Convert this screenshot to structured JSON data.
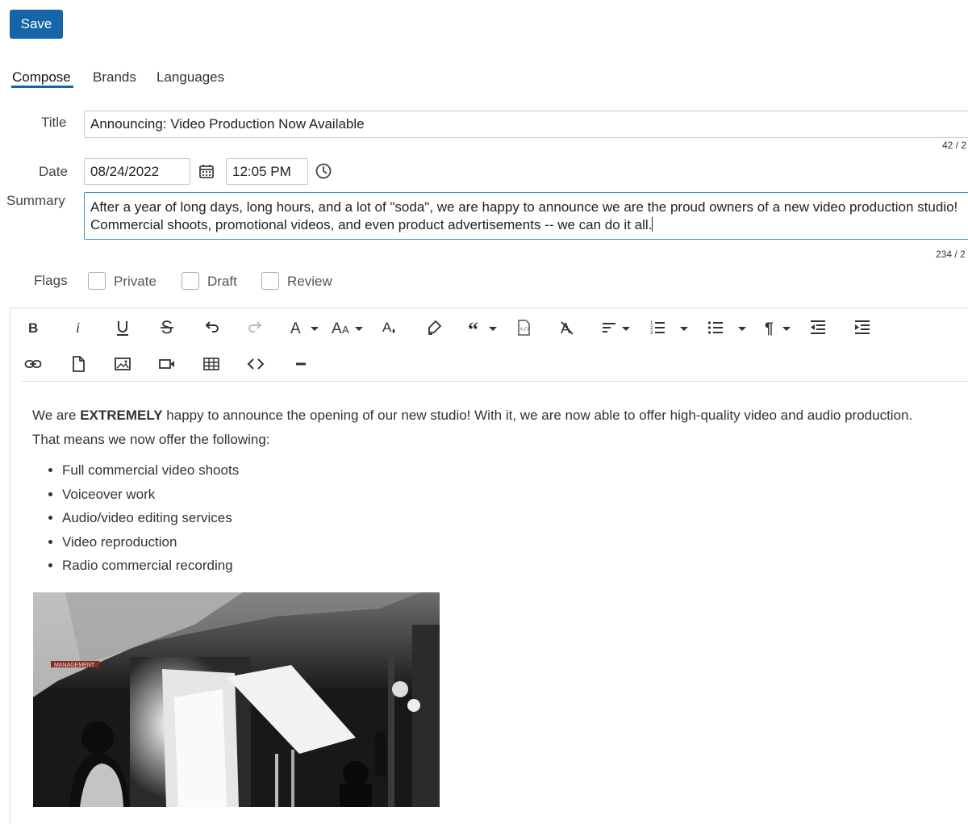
{
  "toolbar_top": {
    "save_label": "Save"
  },
  "tabs": [
    {
      "label": "Compose",
      "active": true
    },
    {
      "label": "Brands",
      "active": false
    },
    {
      "label": "Languages",
      "active": false
    }
  ],
  "form": {
    "title": {
      "label": "Title",
      "value": "Announcing: Video Production Now Available",
      "counter": "42 / 2"
    },
    "date": {
      "label": "Date",
      "date_value": "08/24/2022",
      "time_value": "12:05 PM"
    },
    "summary": {
      "label": "Summary",
      "value": "After a year of long days, long hours, and a lot of \"soda\", we are happy to announce we are the proud owners of a new video production studio! Commercial shoots, promotional videos, and even product advertisements -- we can do it all.",
      "counter": "234 / 2"
    },
    "flags": {
      "label": "Flags",
      "options": [
        {
          "label": "Private",
          "checked": false
        },
        {
          "label": "Draft",
          "checked": false
        },
        {
          "label": "Review",
          "checked": false
        }
      ]
    }
  },
  "editor_toolbar": {
    "row1": [
      "bold-icon",
      "italic-icon",
      "underline-icon",
      "strikethrough-icon",
      "undo-icon",
      "redo-icon",
      "font-family-icon",
      "font-size-icon",
      "text-color-icon",
      "highlight-icon",
      "blockquote-icon",
      "embed-code-icon",
      "clear-format-icon",
      "align-icon",
      "ordered-list-icon",
      "unordered-list-icon",
      "paragraph-format-icon",
      "outdent-icon",
      "indent-icon"
    ],
    "row2": [
      "link-icon",
      "file-icon",
      "image-icon",
      "video-icon",
      "table-icon",
      "code-view-icon",
      "horizontal-line-icon"
    ]
  },
  "content": {
    "intro_before": "We are ",
    "intro_bold": "EXTREMELY",
    "intro_after": " happy to announce the opening of our new studio! With it, we are now able to offer high-quality video and audio production. That means we now offer the following:",
    "list": [
      "Full commercial video shoots",
      "Voiceover work",
      "Audio/video editing services",
      "Video reproduction",
      "Radio commercial recording"
    ],
    "photo_sign_text": "MANAGEMENT"
  },
  "colors": {
    "accent": "#1565a8",
    "focus_border": "#3a8fd0"
  }
}
